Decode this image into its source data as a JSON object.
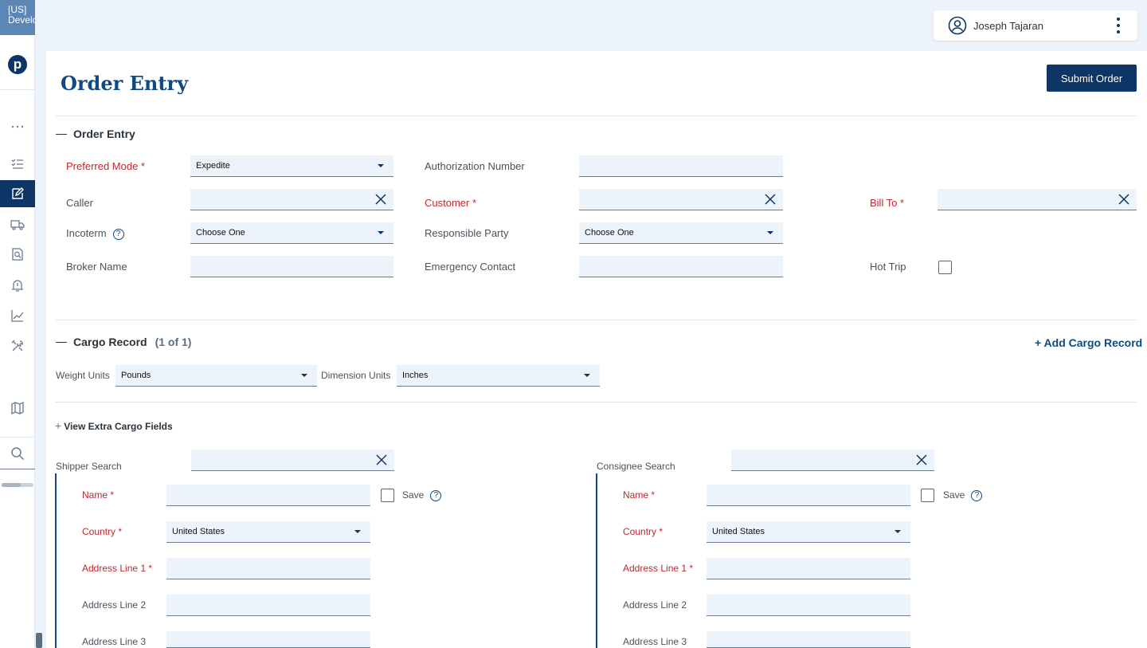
{
  "sidebar": {
    "env_line1": "[US]",
    "env_line2": "Develo",
    "logo_letter": "p",
    "icons": [
      "more-icon",
      "checklist-icon",
      "edit-order-icon",
      "truck-icon",
      "document-search-icon",
      "alert-icon",
      "chart-icon",
      "tools-icon",
      "map-icon",
      "search-icon"
    ],
    "active_icon": "edit-order-icon"
  },
  "header": {
    "user_name": "Joseph Tajaran"
  },
  "page": {
    "title": "Order Entry",
    "submit_label": "Submit Order"
  },
  "order_entry": {
    "section_title": "Order Entry",
    "preferred_mode_label": "Preferred Mode *",
    "preferred_mode_value": "Expedite",
    "authorization_label": "Authorization Number",
    "caller_label": "Caller",
    "customer_label": "Customer *",
    "bill_to_label": "Bill To *",
    "incoterm_label": "Incoterm",
    "incoterm_value": "Choose One",
    "responsible_label": "Responsible Party",
    "responsible_value": "Choose One",
    "broker_label": "Broker Name",
    "emergency_label": "Emergency Contact",
    "hot_trip_label": "Hot Trip",
    "help_glyph": "?"
  },
  "cargo": {
    "section_title": "Cargo Record",
    "count": "(1 of 1)",
    "add_label": "+ Add Cargo Record",
    "weight_label": "Weight Units",
    "weight_value": "Pounds",
    "dimension_label": "Dimension Units",
    "dimension_value": "Inches",
    "view_extra_plus": "+",
    "view_extra_label": "View Extra Cargo Fields"
  },
  "shipper": {
    "search_label": "Shipper Search",
    "name_label": "Name *",
    "save_label": "Save",
    "country_label": "Country *",
    "country_value": "United States",
    "address1_label": "Address Line 1 *",
    "address2_label": "Address Line 2",
    "address3_label": "Address Line 3"
  },
  "consignee": {
    "search_label": "Consignee Search",
    "name_label": "Name *",
    "save_label": "Save",
    "country_label": "Country *",
    "country_value": "United States",
    "address1_label": "Address Line 1 *",
    "address2_label": "Address Line 2",
    "address3_label": "Address Line 3"
  },
  "colors": {
    "primary": "#0d3565",
    "link": "#104a82",
    "required": "#c1272d",
    "field_bg": "#edf3fa"
  }
}
